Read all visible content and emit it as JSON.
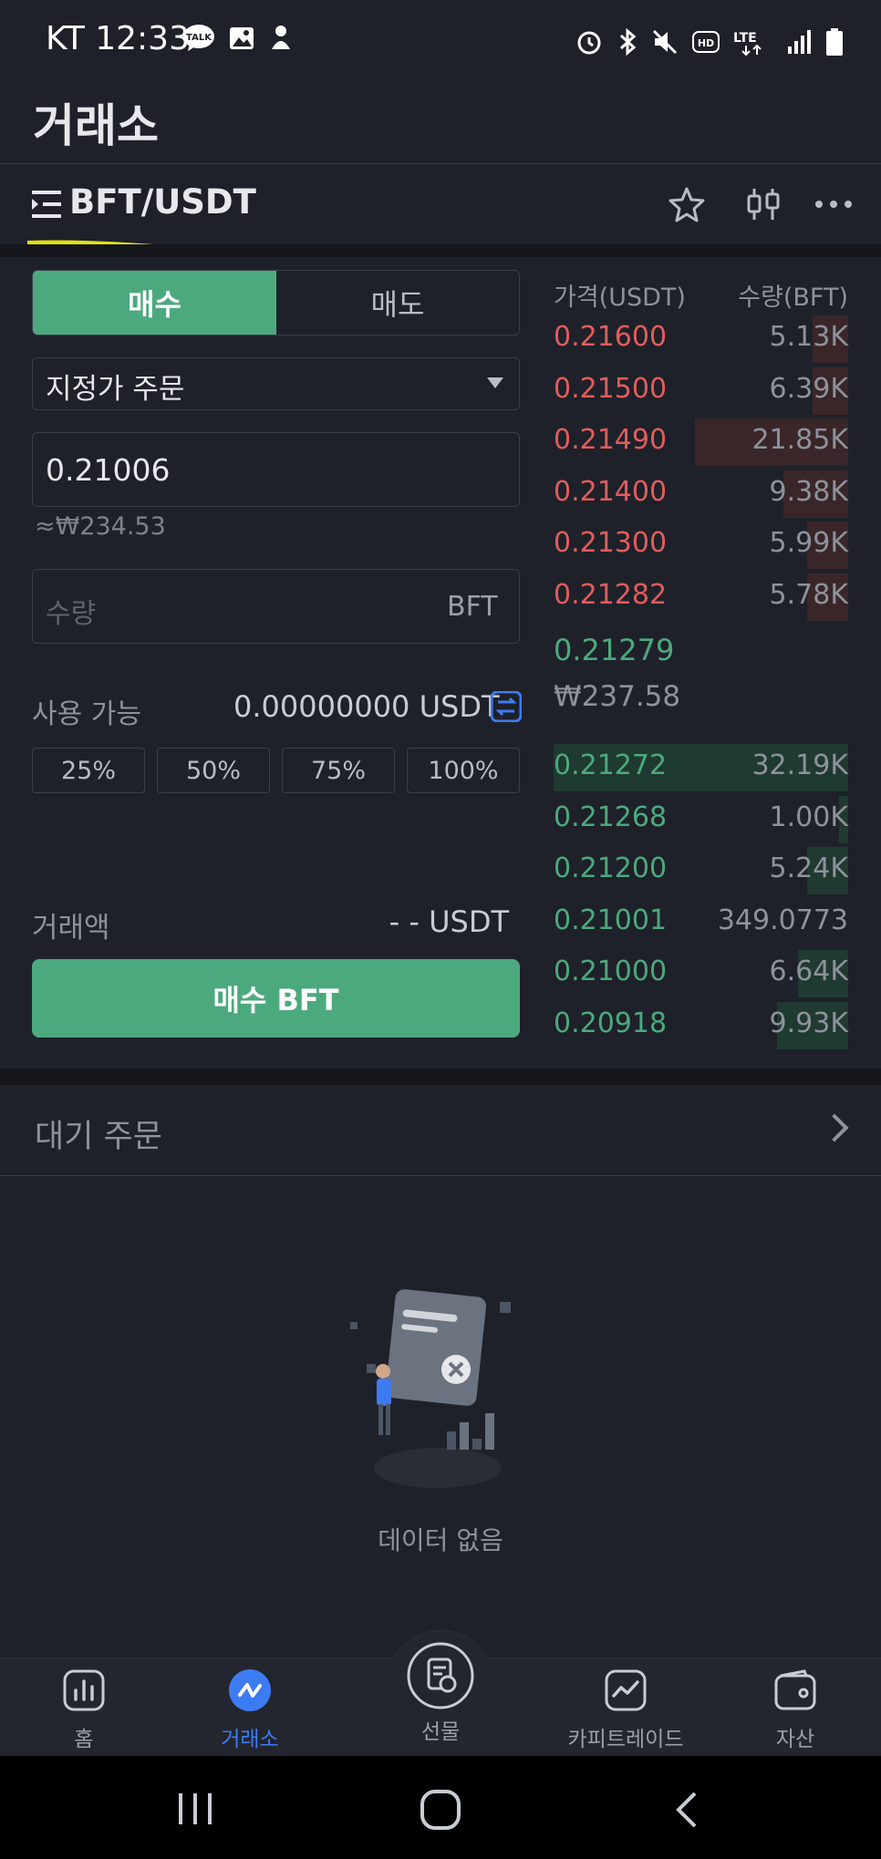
{
  "status_bar": {
    "carrier_time": "KT 12:33",
    "talk_badge": "TALK"
  },
  "header": {
    "title": "거래소"
  },
  "pair": {
    "name": "BFT/USDT"
  },
  "order_form": {
    "buy_tab": "매수",
    "sell_tab": "매도",
    "order_type": "지정가 주문",
    "price_value": "0.21006",
    "price_krw": "≈₩234.53",
    "qty_placeholder": "수량",
    "qty_unit": "BFT",
    "available_label": "사용 가능",
    "available_value": "0.00000000 USDT",
    "percent_buttons": [
      "25%",
      "50%",
      "75%",
      "100%"
    ],
    "amount_label": "거래액",
    "amount_value": "- - USDT",
    "buy_button": "매수 BFT"
  },
  "order_book": {
    "header_price": "가격(USDT)",
    "header_qty": "수량(BFT)",
    "asks": [
      {
        "price": "0.21600",
        "qty": "5.13K",
        "depth": 0.12
      },
      {
        "price": "0.21500",
        "qty": "6.39K",
        "depth": 0.12
      },
      {
        "price": "0.21490",
        "qty": "21.85K",
        "depth": 0.52
      },
      {
        "price": "0.21400",
        "qty": "9.38K",
        "depth": 0.22
      },
      {
        "price": "0.21300",
        "qty": "5.99K",
        "depth": 0.14
      },
      {
        "price": "0.21282",
        "qty": "5.78K",
        "depth": 0.14
      }
    ],
    "last_price": "0.21279",
    "last_price_krw": "₩237.58",
    "bids": [
      {
        "price": "0.21272",
        "qty": "32.19K",
        "depth": 1.0
      },
      {
        "price": "0.21268",
        "qty": "1.00K",
        "depth": 0.03
      },
      {
        "price": "0.21200",
        "qty": "5.24K",
        "depth": 0.14
      },
      {
        "price": "0.21001",
        "qty": "349.0773",
        "depth": 0.0
      },
      {
        "price": "0.21000",
        "qty": "6.64K",
        "depth": 0.17
      },
      {
        "price": "0.20918",
        "qty": "9.93K",
        "depth": 0.24
      }
    ]
  },
  "pending_orders": {
    "label": "대기 주문",
    "empty_text": "데이터 없음"
  },
  "bottom_nav": {
    "items": [
      {
        "label": "홈",
        "icon": "chart-bars-icon"
      },
      {
        "label": "거래소",
        "icon": "exchange-icon"
      },
      {
        "label": "선물",
        "icon": "futures-icon"
      },
      {
        "label": "카피트레이드",
        "icon": "copy-trade-icon"
      },
      {
        "label": "자산",
        "icon": "wallet-icon"
      }
    ],
    "active_index": 1
  },
  "colors": {
    "background": "#1e2129",
    "buy_green": "#4ca97e",
    "sell_red": "#e25c5c",
    "accent_blue": "#3d7bf2",
    "highlight_yellow": "#e0e016"
  }
}
